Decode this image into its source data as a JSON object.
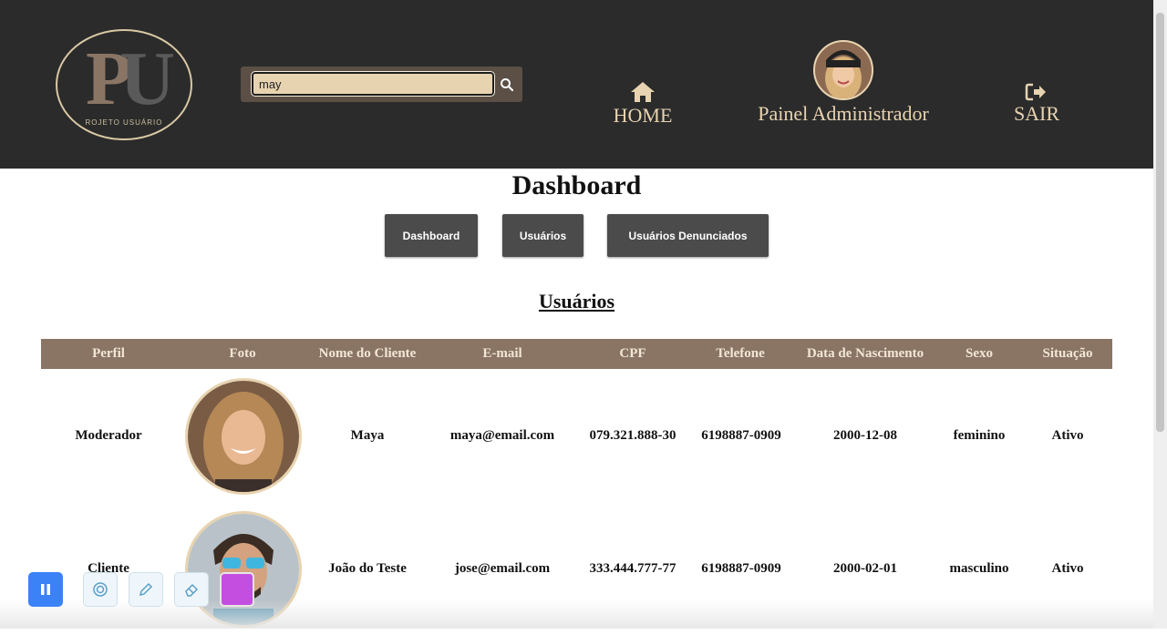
{
  "logo": {
    "mark_p": "P",
    "mark_u": "U",
    "subtitle": "ROJETO USUÁRIO"
  },
  "search": {
    "value": "may",
    "placeholder": ""
  },
  "nav": {
    "home": "HOME",
    "admin": "Painel Administrador",
    "exit": "SAIR"
  },
  "page": {
    "title": "Dashboard"
  },
  "tabs": [
    {
      "label": "Dashboard"
    },
    {
      "label": "Usuários"
    },
    {
      "label": "Usuários Denunciados"
    }
  ],
  "section": {
    "title": "Usuários"
  },
  "table": {
    "headers": [
      "Perfil",
      "Foto",
      "Nome do Cliente",
      "E-mail",
      "CPF",
      "Telefone",
      "Data de Nascimento",
      "Sexo",
      "Situação"
    ],
    "rows": [
      {
        "perfil": "Moderador",
        "nome": "Maya",
        "email": "maya@email.com",
        "cpf": "079.321.888-30",
        "telefone": "6198887-0909",
        "nascimento": "2000-12-08",
        "sexo": "feminino",
        "situacao": "Ativo"
      },
      {
        "perfil": "Cliente",
        "nome": "João do Teste",
        "email": "jose@email.com",
        "cpf": "333.444.777-77",
        "telefone": "6198887-0909",
        "nascimento": "2000-02-01",
        "sexo": "masculino",
        "situacao": "Ativo"
      }
    ]
  },
  "toolbar": {
    "pause_icon": "pause-icon",
    "touch_icon": "touch-icon",
    "pencil_icon": "pencil-icon",
    "eraser_icon": "eraser-icon",
    "color": "#c34ee0"
  },
  "colors": {
    "header_bg": "#2b2b2b",
    "accent": "#e8d3b0",
    "table_header": "#8a7565",
    "button_bg": "#4b4b4b"
  }
}
